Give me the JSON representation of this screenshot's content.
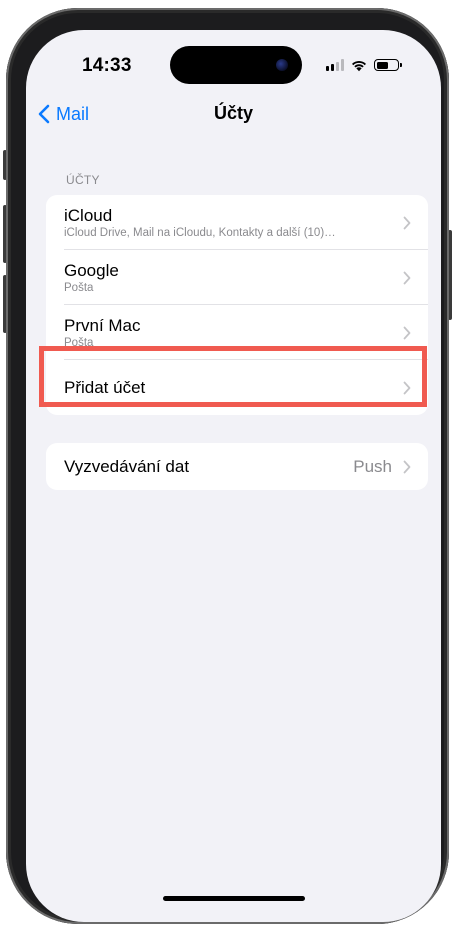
{
  "status_bar": {
    "time": "14:33"
  },
  "nav": {
    "back_label": "Mail",
    "title": "Účty"
  },
  "accounts_section": {
    "header": "ÚČTY",
    "items": [
      {
        "title": "iCloud",
        "subtitle": "iCloud Drive, Mail na iCloudu, Kontakty a další (10)…"
      },
      {
        "title": "Google",
        "subtitle": "Pošta"
      },
      {
        "title": "První Mac",
        "subtitle": "Pošta"
      },
      {
        "title": "Přidat účet"
      }
    ]
  },
  "fetch_section": {
    "label": "Vyzvedávání dat",
    "value": "Push"
  },
  "colors": {
    "accent": "#0a7aff",
    "highlight": "#f05a50",
    "background": "#f2f2f7"
  },
  "icons": [
    "chevron-left-icon",
    "chevron-right-icon",
    "signal-icon",
    "wifi-icon",
    "battery-icon"
  ]
}
